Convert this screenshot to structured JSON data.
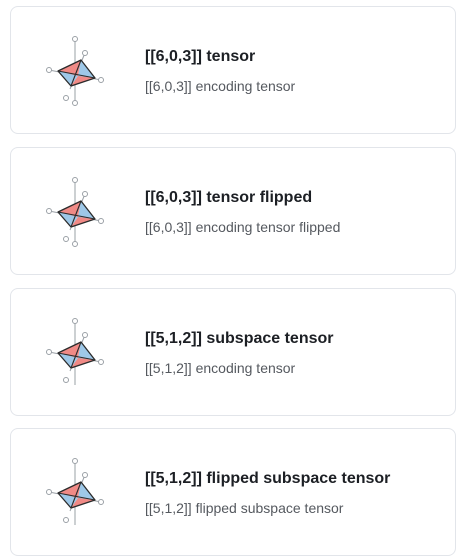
{
  "items": [
    {
      "title": "[[6,0,3]] tensor",
      "subtitle": "[[6,0,3]] encoding tensor",
      "icon": "tensor-network-icon"
    },
    {
      "title": "[[6,0,3]] tensor flipped",
      "subtitle": "[[6,0,3]] encoding tensor flipped",
      "icon": "tensor-network-icon"
    },
    {
      "title": "[[5,1,2]] subspace tensor",
      "subtitle": "[[5,1,2]] encoding tensor",
      "icon": "tensor-network-icon"
    },
    {
      "title": "[[5,1,2]] flipped subspace tensor",
      "subtitle": "[[5,1,2]] flipped subspace tensor",
      "icon": "tensor-network-icon"
    }
  ],
  "colors": {
    "red": "#f08a86",
    "blue": "#9ec8e8",
    "line": "#9aa0a6",
    "stroke": "#2b2b2b"
  }
}
